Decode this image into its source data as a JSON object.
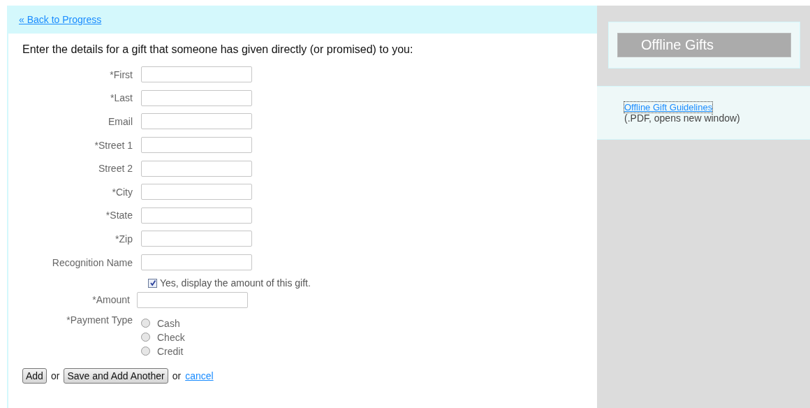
{
  "back_link": "« Back to Progress",
  "intro": "Enter the details for a gift that someone has given directly (or promised) to you:",
  "fields": [
    {
      "label": "*First"
    },
    {
      "label": "*Last"
    },
    {
      "label": "Email"
    },
    {
      "label": "*Street 1"
    },
    {
      "label": "Street 2"
    },
    {
      "label": "*City"
    },
    {
      "label": "*State"
    },
    {
      "label": "*Zip"
    },
    {
      "label": "Recognition Name"
    }
  ],
  "display_amount": {
    "label": "Yes, display the amount of this gift.",
    "checked": true
  },
  "amount": {
    "label": "*Amount"
  },
  "payment_type": {
    "label": "*Payment Type",
    "options": [
      {
        "label": "Cash",
        "selected": false
      },
      {
        "label": "Check",
        "selected": false
      },
      {
        "label": "Credit",
        "selected": false
      }
    ]
  },
  "actions": {
    "add": "Add",
    "or_1": "or",
    "save_another": "Save and Add Another",
    "or_2": "or",
    "cancel": "cancel"
  },
  "sidebar": {
    "title": "Offline Gifts",
    "link": "Offline Gift Guidelines",
    "note": "(.PDF, opens new window)"
  }
}
